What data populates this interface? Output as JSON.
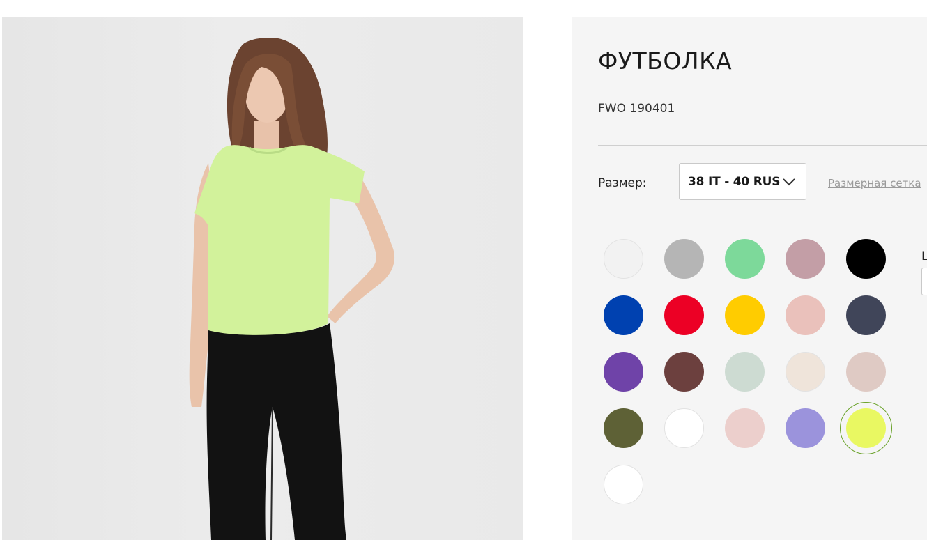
{
  "product": {
    "title": "ФУТБОЛКА",
    "sku": "FWO 190401"
  },
  "size": {
    "label": "Размер:",
    "selected": "38 IT - 40 RUS",
    "chart_link": "Размерная сетка"
  },
  "colors": {
    "selected_index": 19,
    "swatches": [
      {
        "hex": "#f2f2f2"
      },
      {
        "hex": "#b5b5b5"
      },
      {
        "hex": "#7dd99a"
      },
      {
        "hex": "#c39ea6"
      },
      {
        "hex": "#000000"
      },
      {
        "hex": "#0041b0"
      },
      {
        "hex": "#ec0025"
      },
      {
        "hex": "#ffcc00"
      },
      {
        "hex": "#eac1bb"
      },
      {
        "hex": "#404559"
      },
      {
        "hex": "#6f43a8"
      },
      {
        "hex": "#6c403e"
      },
      {
        "hex": "#cddbd2"
      },
      {
        "hex": "#efe4da"
      },
      {
        "hex": "#dfcac4"
      },
      {
        "hex": "#5e6136"
      },
      {
        "hex": "#ffffff"
      },
      {
        "hex": "#eccfcc"
      },
      {
        "hex": "#9b93dc"
      },
      {
        "hex": "#e9f862"
      },
      {
        "hex": "#ffffff"
      }
    ]
  },
  "side_panel": {
    "label": "L"
  }
}
